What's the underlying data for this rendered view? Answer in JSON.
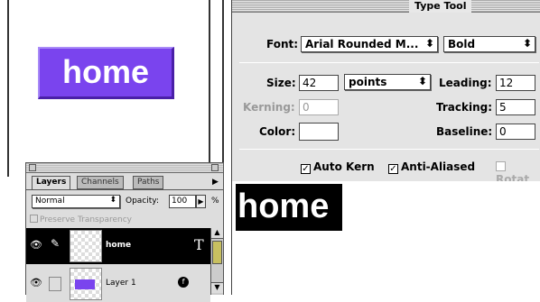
{
  "canvas": {
    "button_text": "home",
    "button_color": "#7a44ee"
  },
  "layers_palette": {
    "tabs": [
      "Layers",
      "Channels",
      "Paths"
    ],
    "blend_mode": "Normal",
    "opacity_label": "Opacity:",
    "opacity_value": "100",
    "opacity_unit": "%",
    "preserve_transparency": "Preserve Transparency",
    "layers": [
      {
        "name": "home",
        "type_badge": "T"
      },
      {
        "name": "Layer 1",
        "fx_badge": "f"
      }
    ]
  },
  "type_tool": {
    "title": "Type Tool",
    "font_label": "Font:",
    "font_value": "Arial Rounded M...",
    "style_value": "Bold",
    "size_label": "Size:",
    "size_value": "42",
    "unit_value": "points",
    "leading_label": "Leading:",
    "leading_value": "12",
    "kerning_label": "Kerning:",
    "kerning_value": "0",
    "tracking_label": "Tracking:",
    "tracking_value": "5",
    "color_label": "Color:",
    "baseline_label": "Baseline:",
    "baseline_value": "0",
    "auto_kern": "Auto Kern",
    "anti_aliased": "Anti-Aliased",
    "rotate": "Rotat"
  },
  "preview": {
    "text": "home"
  },
  "icons": {
    "eye": "eye-icon",
    "brush": "brush-icon",
    "type": "type-layer-icon",
    "caret": "updown-caret-icon"
  }
}
